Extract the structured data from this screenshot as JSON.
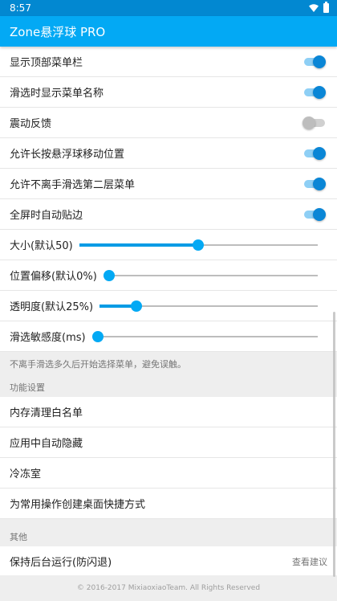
{
  "status_bar": {
    "time": "8:57"
  },
  "app_bar": {
    "title": "Zone悬浮球 PRO"
  },
  "toggles": [
    {
      "label": "显示顶部菜单栏",
      "on": true
    },
    {
      "label": "滑选时显示菜单名称",
      "on": true
    },
    {
      "label": "震动反馈",
      "on": false
    },
    {
      "label": "允许长按悬浮球移动位置",
      "on": true
    },
    {
      "label": "允许不离手滑选第二层菜单",
      "on": true
    },
    {
      "label": "全屏时自动贴边",
      "on": true
    }
  ],
  "sliders": [
    {
      "label": "大小(默认50)",
      "value_fraction": 0.5
    },
    {
      "label": "位置偏移(默认0%)",
      "value_fraction": 0.0
    },
    {
      "label": "透明度(默认25%)",
      "value_fraction": 0.17
    },
    {
      "label": "滑选敏感度(ms)",
      "value_fraction": 0.0
    }
  ],
  "slider_hint": "不离手滑选多久后开始选择菜单，避免误触。",
  "function_section": {
    "header": "功能设置",
    "items": [
      "内存清理白名单",
      "应用中自动隐藏",
      "冷冻室",
      "为常用操作创建桌面快捷方式"
    ]
  },
  "other_section": {
    "header": "其他",
    "item_label": "保持后台运行(防闪退)",
    "item_action": "查看建议"
  },
  "footer": "© 2016-2017 MixiaoxiaoTeam. All Rights Reserved",
  "colors": {
    "primary": "#03a9f4",
    "primary_dark": "#0288d1",
    "accent": "#0a86d6"
  }
}
